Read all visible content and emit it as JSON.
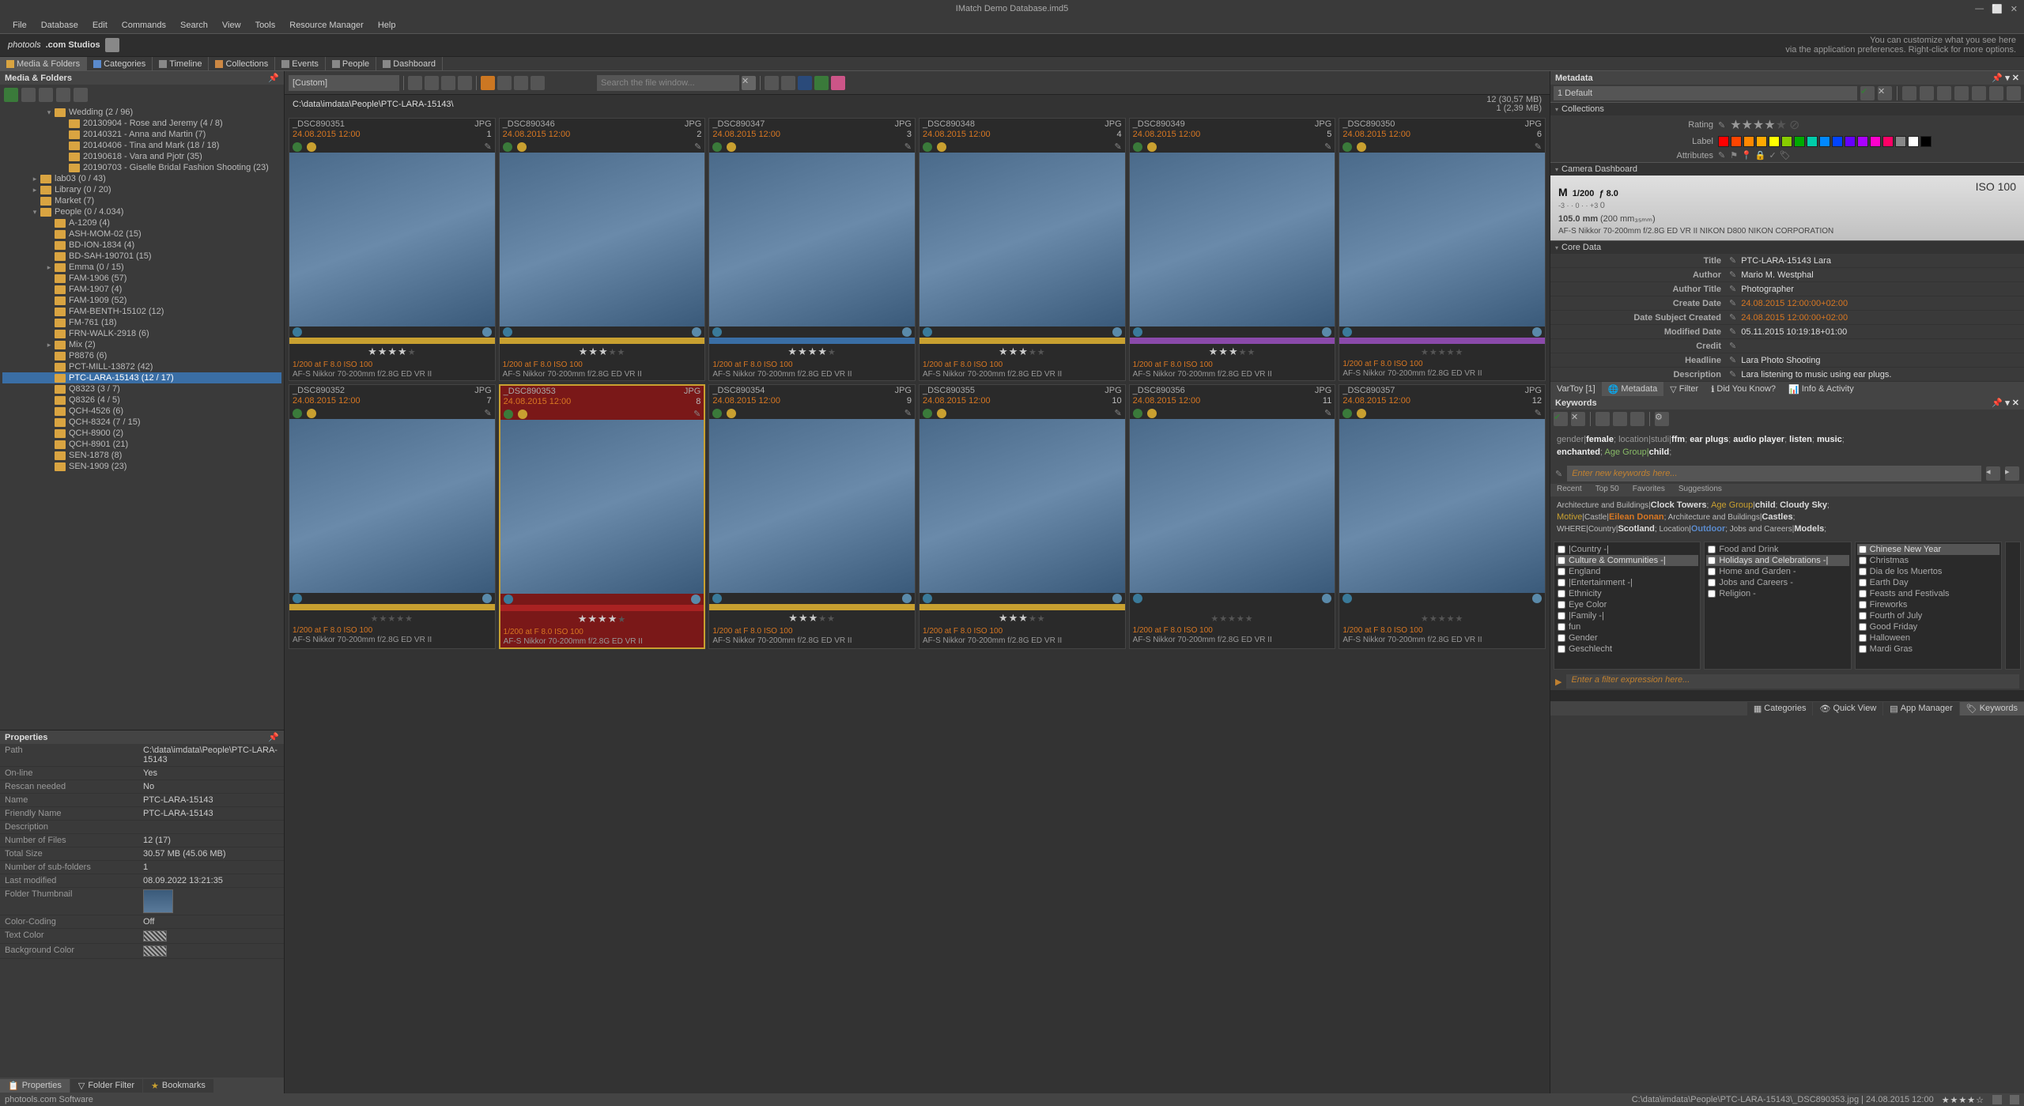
{
  "titlebar": {
    "title": "IMatch Demo Database.imd5"
  },
  "menubar": [
    "File",
    "Database",
    "Edit",
    "Commands",
    "Search",
    "View",
    "Tools",
    "Resource Manager",
    "Help"
  ],
  "brand": {
    "text_prefix": "photools",
    "text_suffix": ".com Studios",
    "hint_l1": "You can customize what you see here",
    "hint_l2": "via the application preferences. Right-click for more options."
  },
  "category_tabs": [
    {
      "label": "Media & Folders",
      "active": true
    },
    {
      "label": "Categories"
    },
    {
      "label": "Timeline"
    },
    {
      "label": "Collections"
    },
    {
      "label": "Events"
    },
    {
      "label": "People"
    },
    {
      "label": "Dashboard"
    }
  ],
  "left": {
    "panel_title": "Media & Folders",
    "tree": [
      {
        "d": 3,
        "exp": "▾",
        "label": "Wedding (2 / 96)"
      },
      {
        "d": 4,
        "label": "20130904 - Rose and Jeremy (4 / 8)"
      },
      {
        "d": 4,
        "label": "20140321 - Anna and Martin (7)"
      },
      {
        "d": 4,
        "label": "20140406 - Tina and Mark (18 / 18)"
      },
      {
        "d": 4,
        "label": "20190618 - Vara and Pjotr (35)"
      },
      {
        "d": 4,
        "label": "20190703 - Giselle Bridal Fashion Shooting (23)"
      },
      {
        "d": 2,
        "exp": "▸",
        "label": "lab03 (0 / 43)"
      },
      {
        "d": 2,
        "exp": "▸",
        "label": "Library (0 / 20)"
      },
      {
        "d": 2,
        "label": "Market (7)"
      },
      {
        "d": 2,
        "exp": "▾",
        "label": "People (0 / 4.034)"
      },
      {
        "d": 3,
        "label": "A-1209 (4)"
      },
      {
        "d": 3,
        "label": "ASH-MOM-02 (15)"
      },
      {
        "d": 3,
        "label": "BD-ION-1834 (4)"
      },
      {
        "d": 3,
        "label": "BD-SAH-190701 (15)"
      },
      {
        "d": 3,
        "exp": "▸",
        "label": "Emma (0 / 15)"
      },
      {
        "d": 3,
        "label": "FAM-1906 (57)"
      },
      {
        "d": 3,
        "label": "FAM-1907 (4)"
      },
      {
        "d": 3,
        "label": "FAM-1909 (52)"
      },
      {
        "d": 3,
        "label": "FAM-BENTH-15102 (12)"
      },
      {
        "d": 3,
        "label": "FM-761 (18)"
      },
      {
        "d": 3,
        "label": "FRN-WALK-2918 (6)"
      },
      {
        "d": 3,
        "exp": "▸",
        "label": "Mix (2)"
      },
      {
        "d": 3,
        "label": "P8876 (6)"
      },
      {
        "d": 3,
        "label": "PCT-MILL-13872 (42)"
      },
      {
        "d": 3,
        "label": "PTC-LARA-15143 (12 / 17)",
        "sel": true
      },
      {
        "d": 3,
        "label": "Q8323 (3 / 7)"
      },
      {
        "d": 3,
        "label": "Q8326 (4 / 5)"
      },
      {
        "d": 3,
        "label": "QCH-4526 (6)"
      },
      {
        "d": 3,
        "label": "QCH-8324 (7 / 15)"
      },
      {
        "d": 3,
        "label": "QCH-8900 (2)"
      },
      {
        "d": 3,
        "label": "QCH-8901 (21)"
      },
      {
        "d": 3,
        "label": "SEN-1878 (8)"
      },
      {
        "d": 3,
        "label": "SEN-1909 (23)"
      }
    ],
    "props_title": "Properties",
    "props": [
      {
        "k": "Path",
        "v": "C:\\data\\imdata\\People\\PTC-LARA-15143"
      },
      {
        "k": "On-line",
        "v": "Yes"
      },
      {
        "k": "Rescan needed",
        "v": "No"
      },
      {
        "k": "Name",
        "v": "PTC-LARA-15143"
      },
      {
        "k": "Friendly Name",
        "v": "PTC-LARA-15143"
      },
      {
        "k": "Description",
        "v": ""
      },
      {
        "k": "Number of Files",
        "v": "12 (17)"
      },
      {
        "k": "Total Size",
        "v": "30.57 MB (45.06 MB)"
      },
      {
        "k": "Number of sub-folders",
        "v": "1"
      },
      {
        "k": "Last modified",
        "v": "08.09.2022 13:21:35"
      },
      {
        "k": "Folder Thumbnail",
        "v": "__thumb__"
      },
      {
        "k": "Color-Coding",
        "v": "Off"
      },
      {
        "k": "Text Color",
        "v": "__hatch__"
      },
      {
        "k": "Background Color",
        "v": "__hatch__"
      }
    ],
    "bottom_tabs": [
      {
        "label": "Properties",
        "active": true
      },
      {
        "label": "Folder Filter"
      },
      {
        "label": "Bookmarks"
      }
    ]
  },
  "center": {
    "layout_combo": "[Custom]",
    "search_placeholder": "Search the file window...",
    "breadcrumb": "C:\\data\\imdata\\People\\PTC-LARA-15143\\",
    "stat_files": "12 (30,57 MB)",
    "stat_sel": "1 (2,39 MB)",
    "common_date": "24.08.2015 12:00",
    "common_exposure": "1/200 at F 8.0 ISO 100",
    "common_lens": "AF-S Nikkor 70-200mm f/2.8G ED VR II",
    "thumbs": [
      {
        "name": "_DSC890351",
        "ext": "JPG",
        "seq": "1",
        "stars": 4,
        "bar": "yellow"
      },
      {
        "name": "_DSC890346",
        "ext": "JPG",
        "seq": "2",
        "stars": 3,
        "bar": "yellow"
      },
      {
        "name": "_DSC890347",
        "ext": "JPG",
        "seq": "3",
        "stars": 4,
        "bar": "blue"
      },
      {
        "name": "_DSC890348",
        "ext": "JPG",
        "seq": "4",
        "stars": 3,
        "bar": "yellow"
      },
      {
        "name": "_DSC890349",
        "ext": "JPG",
        "seq": "5",
        "stars": 3,
        "bar": "purple"
      },
      {
        "name": "_DSC890350",
        "ext": "JPG",
        "seq": "6",
        "stars": 0,
        "bar": "purple"
      },
      {
        "name": "_DSC890352",
        "ext": "JPG",
        "seq": "7",
        "stars": 0,
        "bar": "yellow"
      },
      {
        "name": "_DSC890353",
        "ext": "JPG",
        "seq": "8",
        "stars": 4,
        "bar": "red",
        "selected": true
      },
      {
        "name": "_DSC890354",
        "ext": "JPG",
        "seq": "9",
        "stars": 3,
        "bar": "yellow"
      },
      {
        "name": "_DSC890355",
        "ext": "JPG",
        "seq": "10",
        "stars": 3,
        "bar": "yellow"
      },
      {
        "name": "_DSC890356",
        "ext": "JPG",
        "seq": "11",
        "stars": 0,
        "bar": ""
      },
      {
        "name": "_DSC890357",
        "ext": "JPG",
        "seq": "12",
        "stars": 0,
        "bar": ""
      }
    ]
  },
  "right": {
    "meta_title": "Metadata",
    "meta_layout": "1 Default",
    "section_collections": "Collections",
    "rating_label": "Rating",
    "label_label": "Label",
    "attr_label": "Attributes",
    "label_colors": [
      "#ff0000",
      "#ff4500",
      "#ff8800",
      "#ffaa00",
      "#ffff00",
      "#88cc00",
      "#00aa00",
      "#00ccaa",
      "#0088ff",
      "#0044ff",
      "#6600ff",
      "#aa00ff",
      "#ff00cc",
      "#ff0066",
      "#888888",
      "#ffffff",
      "#000000"
    ],
    "section_camera": "Camera Dashboard",
    "camera": {
      "mode": "M",
      "exposure": "1/200",
      "aperture": "ƒ 8.0",
      "iso": "ISO 100",
      "focal": "105.0 mm",
      "focal_sub": "(200 mm₃₅ₘₘ)",
      "comp": "0",
      "lens_line": "AF-S Nikkor 70-200mm f/2.8G ED VR II    NIKON D800 NIKON CORPORATION"
    },
    "section_core": "Core Data",
    "core": [
      {
        "k": "Title",
        "v": "PTC-LARA-15143 Lara"
      },
      {
        "k": "Author",
        "v": "Mario M. Westphal"
      },
      {
        "k": "Author Title",
        "v": "Photographer"
      },
      {
        "k": "Create Date",
        "v": "24.08.2015 12:00:00+02:00",
        "orange": true
      },
      {
        "k": "Date Subject Created",
        "v": "24.08.2015 12:00:00+02:00",
        "orange": true
      },
      {
        "k": "Modified Date",
        "v": "05.11.2015 10:19:18+01:00"
      },
      {
        "k": "Credit",
        "v": ""
      },
      {
        "k": "Headline",
        "v": "Lara Photo Shooting"
      },
      {
        "k": "Description",
        "v": "Lara listening to music using ear plugs."
      }
    ],
    "meta_tabs": [
      {
        "label": "VarToy [1]"
      },
      {
        "label": "Metadata",
        "active": true
      },
      {
        "label": "Filter"
      },
      {
        "label": "Did You Know?"
      },
      {
        "label": "Info & Activity"
      }
    ],
    "kw_title": "Keywords",
    "kw_text_parts": [
      {
        "c": "kwc",
        "t": "gender|"
      },
      {
        "c": "b",
        "t": "female"
      },
      {
        "c": "kwc",
        "t": ";   location|studi|"
      },
      {
        "c": "b",
        "t": "ffm"
      },
      {
        "c": "kwc",
        "t": ";   "
      },
      {
        "c": "b",
        "t": "ear plugs"
      },
      {
        "c": "kwc",
        "t": ";   "
      },
      {
        "c": "b",
        "t": "audio player"
      },
      {
        "c": "kwc",
        "t": ";   "
      },
      {
        "c": "b",
        "t": "listen"
      },
      {
        "c": "kwc",
        "t": ";   "
      },
      {
        "c": "b",
        "t": "music"
      },
      {
        "c": "kwc",
        "t": ";"
      },
      {
        "c": "br"
      },
      {
        "c": "b",
        "t": "enchanted"
      },
      {
        "c": "kwc",
        "t": ";   "
      },
      {
        "c": "k3",
        "t": "Age Group|"
      },
      {
        "c": "b",
        "t": "child"
      },
      {
        "c": "kwc",
        "t": ";"
      }
    ],
    "kw_placeholder": "Enter new keywords here...",
    "kw_suggest_tabs": [
      "Recent",
      "Top 50",
      "Favorites",
      "Suggestions"
    ],
    "kw_suggest_line": "Architecture and Buildings|Clock Towers;   Age Group|child;   Cloudy Sky;\nMotive|Castle|Eilean Donan;   Architecture and Buildings|Castles;\nWHERE|Country|Scotland;   Location|Outdoor;   Jobs and Careers|Models;",
    "kw_cols": [
      [
        "|Country -|",
        "Culture & Communities -|",
        "England",
        "|Entertainment -|",
        "Ethnicity",
        "Eye Color",
        "|Family -|",
        "fun",
        "Gender",
        "Geschlecht"
      ],
      [
        "Food and Drink",
        "Holidays and Celebrations -|",
        "Home and Garden -",
        "Jobs and Careers -",
        "Religion -"
      ],
      [
        "Chinese New Year",
        "Christmas",
        "Dia de los Muertos",
        "Earth Day",
        "Feasts and Festivals",
        "Fireworks",
        "Fourth of July",
        "Good Friday",
        "Halloween",
        "Mardi Gras"
      ]
    ],
    "filter_placeholder": "Enter a filter expression here...",
    "status_tabs": [
      {
        "label": "Categories"
      },
      {
        "label": "Quick View"
      },
      {
        "label": "App Manager"
      },
      {
        "label": "Keywords",
        "active": true
      }
    ]
  },
  "statusbar": {
    "left": "photools.com Software",
    "path": "C:\\data\\imdata\\People\\PTC-LARA-15143\\_DSC890353.jpg | 24.08.2015 12:00",
    "stars": "★★★★☆"
  }
}
